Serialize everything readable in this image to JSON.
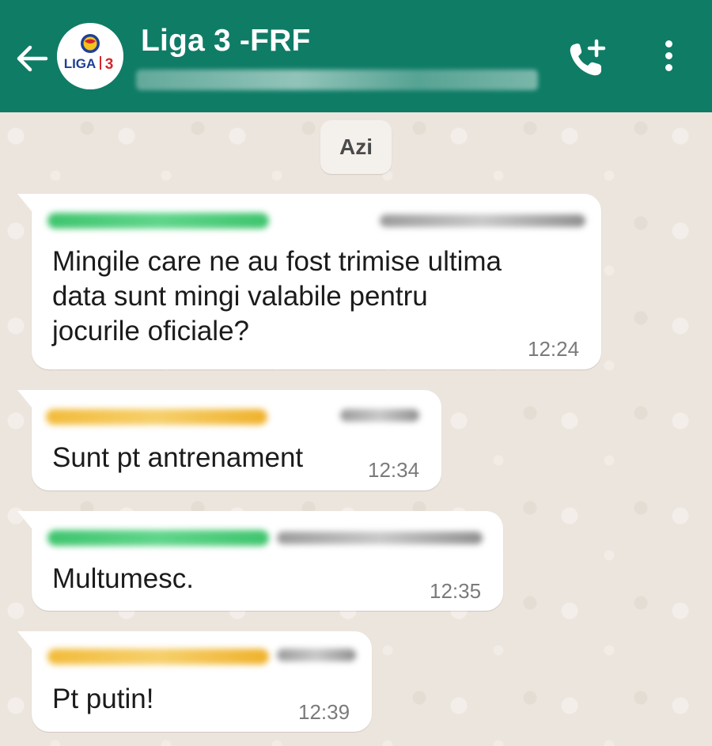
{
  "chat": {
    "title": "Liga 3 -FRF",
    "avatar_text": "LIGA 3"
  },
  "icons": {
    "back": "arrow-left-icon",
    "call": "add-call-icon",
    "menu": "more-vert-icon"
  },
  "colors": {
    "header": "#0f7c66",
    "wallpaper": "#ece5dd",
    "bubble": "#ffffff",
    "sender_green": "#3ec46d",
    "sender_orange": "#f2bb3a"
  },
  "date_separator": "Azi",
  "messages": [
    {
      "text": "Mingile care ne au fost trimise ultima\ndata sunt mingi valabile pentru\njocurile oficiale?",
      "time": "12:24",
      "sender_color": "green"
    },
    {
      "text": "Sunt pt antrenament",
      "time": "12:34",
      "sender_color": "orange"
    },
    {
      "text": "Multumesc.",
      "time": "12:35",
      "sender_color": "green"
    },
    {
      "text": "Pt putin!",
      "time": "12:39",
      "sender_color": "orange"
    }
  ]
}
